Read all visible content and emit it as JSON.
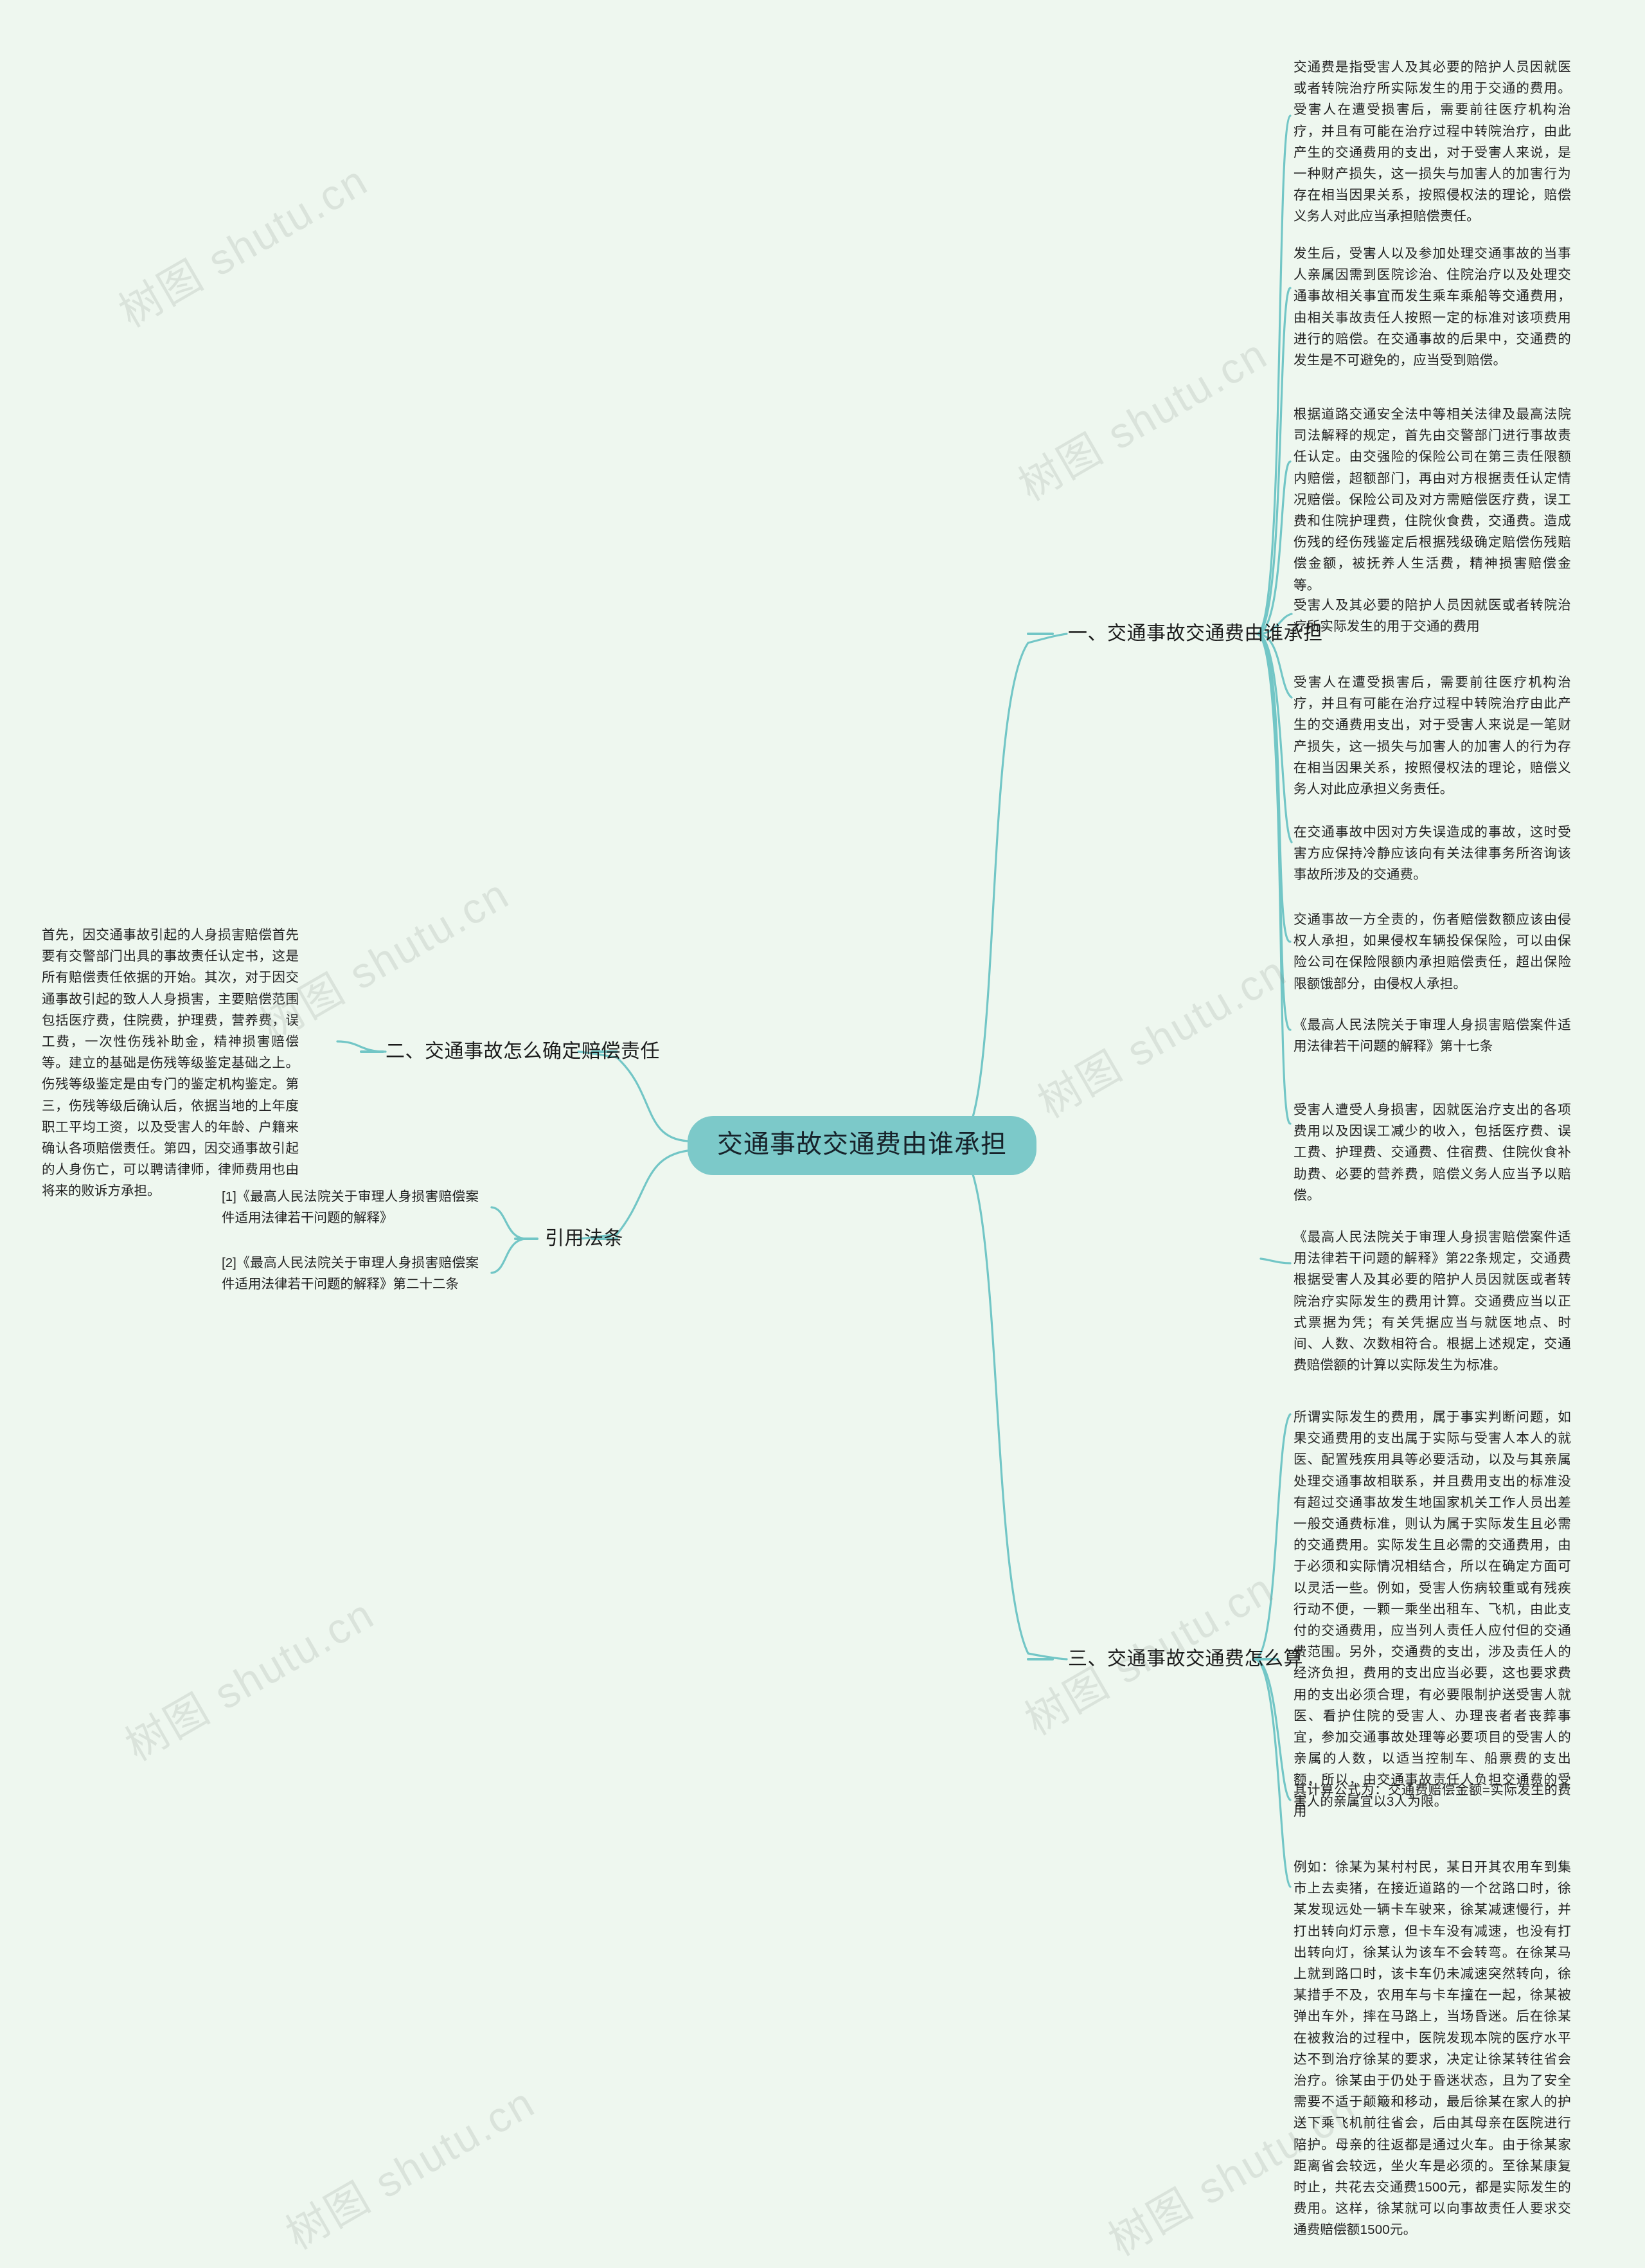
{
  "meta": {
    "background_color": "#eef7ef",
    "accent_color": "#7cc9c9",
    "line_color": "#72c6c6",
    "text_color": "#222222"
  },
  "watermark": {
    "text": "树图 shutu.cn",
    "color": "rgba(120,132,124,0.17)"
  },
  "root": {
    "label": "交通事故交通费由谁承担"
  },
  "branches": [
    {
      "id": "branch-1",
      "label": "一、交通事故交通费由谁承担",
      "side": "right",
      "leaves": [
        {
          "id": "b1-leaf-1",
          "text": "受害人及其必要的陪护人员因就医或者转院治疗所实际发生的用于交通的费用"
        },
        {
          "id": "b1-leaf-2",
          "text": "受害人在遭受损害后，需要前往医疗机构治疗，并且有可能在治疗过程中转院治疗由此产生的交通费用支出，对于受害人来说是一笔财产损失，这一损失与加害人的加害人的行为存在相当因果关系，按照侵权法的理论，赔偿义务人对此应承担义务责任。"
        },
        {
          "id": "b1-leaf-3",
          "text": "在交通事故中因对方失误造成的事故，这时受害方应保持冷静应该向有关法律事务所咨询该事故所涉及的交通费。"
        }
      ]
    },
    {
      "id": "branch-2",
      "label": "二、交通事故怎么确定赔偿责任",
      "side": "left",
      "leaves": [
        {
          "id": "b2-leaf-1",
          "text": "首先，因交通事故引起的人身损害赔偿首先要有交警部门出具的事故责任认定书，这是所有赔偿责任依据的开始。其次，对于因交通事故引起的致人人身损害，主要赔偿范围包括医疗费，住院费，护理费，营养费，误工费，一次性伤残补助金，精神损害赔偿等。建立的基础是伤残等级鉴定基础之上。伤残等级鉴定是由专门的鉴定机构鉴定。第三，伤残等级后确认后，依据当地的上年度职工平均工资，以及受害人的年龄、户籍来确认各项赔偿责任。第四，因交通事故引起的人身伤亡，可以聘请律师，律师费用也由将来的败诉方承担。"
        }
      ],
      "right_leaves": [
        {
          "id": "b2-leaf-2",
          "text": "交通事故一方全责的，伤者赔偿数额应该由侵权人承担，如果侵权车辆投保保险，可以由保险公司在保险限额内承担赔偿责任，超出保险限额饿部分，由侵权人承担。"
        },
        {
          "id": "b2-leaf-3",
          "text": "《最高人民法院关于审理人身损害赔偿案件适用法律若干问题的解释》第十七条"
        },
        {
          "id": "b2-leaf-4",
          "text": "受害人遭受人身损害，因就医治疗支出的各项费用以及因误工减少的收入，包括医疗费、误工费、护理费、交通费、住宿费、住院伙食补助费、必要的营养费，赔偿义务人应当予以赔偿。"
        }
      ]
    },
    {
      "id": "branch-3",
      "label": "三、交通事故交通费怎么算",
      "side": "right",
      "leaves": [
        {
          "id": "b3-leaf-1",
          "text": "所谓实际发生的费用，属于事实判断问题，如果交通费用的支出属于实际与受害人本人的就医、配置残疾用具等必要活动，以及与其亲属处理交通事故相联系，并且费用支出的标准没有超过交通事故发生地国家机关工作人员出差一般交通费标准，则认为属于实际发生且必需的交通费用。实际发生且必需的交通费用，由于必须和实际情况相结合，所以在确定方面可以灵活一些。例如，受害人伤病较重或有残疾行动不便，一颗一乘坐出租车、飞机，由此支付的交通费用，应当列人责任人应付但的交通费范围。另外，交通费的支出，涉及责任人的经济负担，费用的支出应当必要，这也要求费用的支出必须合理，有必要限制护送受害人就医、看护住院的受害人、办理丧者者丧葬事宜，参加交通事故处理等必要项目的受害人的亲属的人数，以适当控制车、船票费的支出额，所以，由交通事故责任人负担交通费的受害人的亲属宜以3人为限。"
        },
        {
          "id": "b3-leaf-2",
          "text": "其计算公式为：交通费赔偿金额=实际发生的费用"
        },
        {
          "id": "b3-leaf-3",
          "text": "例如：徐某为某村村民，某日开其农用车到集市上去卖猪，在接近道路的一个岔路口时，徐某发现远处一辆卡车驶来，徐某减速慢行，并打出转向灯示意，但卡车没有减速，也没有打出转向灯，徐某认为该车不会转弯。在徐某马上就到路口时，该卡车仍未减速突然转向，徐某措手不及，农用车与卡车撞在一起，徐某被弹出车外，摔在马路上，当场昏迷。后在徐某在被救治的过程中，医院发现本院的医疗水平达不到治疗徐某的要求，决定让徐某转往省会治疗。徐某由于仍处于昏迷状态，且为了安全需要不适于颠簸和移动，最后徐某在家人的护送下乘飞机前往省会，后由其母亲在医院进行陪护。母亲的往返都是通过火车。由于徐某家距离省会较远，坐火车是必须的。至徐某康复时止，共花去交通费1500元，都是实际发生的费用。这样，徐某就可以向事故责任人要求交通费赔偿额1500元。"
        }
      ]
    },
    {
      "id": "branch-4",
      "label": "引用法条",
      "side": "left",
      "leaves": [
        {
          "id": "b4-leaf-1",
          "text": "[1]《最高人民法院关于审理人身损害赔偿案件适用法律若干问题的解释》"
        },
        {
          "id": "b4-leaf-2",
          "text": "[2]《最高人民法院关于审理人身损害赔偿案件适用法律若干问题的解释》第二十二条"
        }
      ],
      "right_leaves": [
        {
          "id": "b4-leaf-3",
          "text": "《最高人民法院关于审理人身损害赔偿案件适用法律若干问题的解释》第22条规定，交通费根据受害人及其必要的陪护人员因就医或者转院治疗实际发生的费用计算。交通费应当以正式票据为凭；有关凭据应当与就医地点、时间、人数、次数相符合。根据上述规定，交通费赔偿额的计算以实际发生为标准。"
        }
      ]
    }
  ],
  "top_right_leaves": [
    {
      "id": "top-leaf-1",
      "text": "交通费是指受害人及其必要的陪护人员因就医或者转院治疗所实际发生的用于交通的费用。受害人在遭受损害后，需要前往医疗机构治疗，并且有可能在治疗过程中转院治疗，由此产生的交通费用的支出，对于受害人来说，是一种财产损失，这一损失与加害人的加害行为存在相当因果关系，按照侵权法的理论，赔偿义务人对此应当承担赔偿责任。"
    },
    {
      "id": "top-leaf-2",
      "text": "发生后，受害人以及参加处理交通事故的当事人亲属因需到医院诊治、住院治疗以及处理交通事故相关事宜而发生乘车乘船等交通费用，由相关事故责任人按照一定的标准对该项费用进行的赔偿。在交通事故的后果中，交通费的发生是不可避免的，应当受到赔偿。"
    },
    {
      "id": "top-leaf-3",
      "text": "根据道路交通安全法中等相关法律及最高法院司法解释的规定，首先由交警部门进行事故责任认定。由交强险的保险公司在第三责任限额内赔偿，超额部门，再由对方根据责任认定情况赔偿。保险公司及对方需赔偿医疗费，误工费和住院护理费，住院伙食费，交通费。造成伤残的经伤残鉴定后根据残级确定赔偿伤残赔偿金额，被抚养人生活费，精神损害赔偿金等。"
    }
  ]
}
